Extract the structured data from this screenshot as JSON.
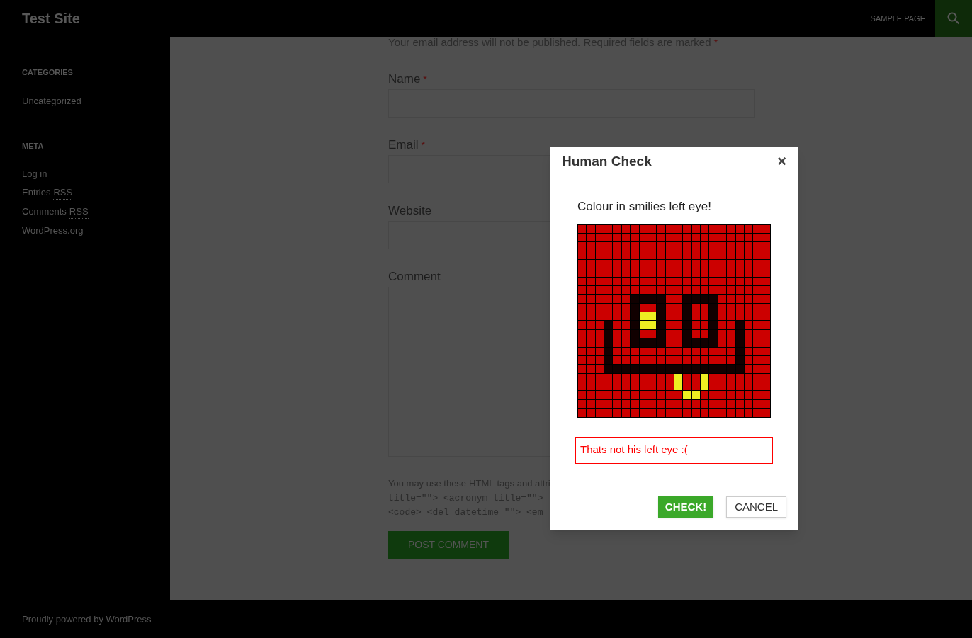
{
  "header": {
    "site_title": "Test Site",
    "nav": [
      {
        "label": "SAMPLE PAGE"
      }
    ]
  },
  "sidebar": {
    "widgets": [
      {
        "title": "CATEGORIES",
        "links": [
          {
            "text": "Uncategorized"
          }
        ]
      },
      {
        "title": "META",
        "links": [
          {
            "text": "Log in"
          },
          {
            "text": "Entries",
            "abbr": "RSS"
          },
          {
            "text": "Comments",
            "abbr": "RSS"
          },
          {
            "text": "WordPress.org"
          }
        ]
      }
    ]
  },
  "form": {
    "notes": "Your email address will not be published. Required fields are marked",
    "notes_mark": "*",
    "fields": [
      {
        "label": "Name",
        "required_mark": "*",
        "kind": "input"
      },
      {
        "label": "Email",
        "required_mark": "*",
        "kind": "input"
      },
      {
        "label": "Website",
        "kind": "input"
      },
      {
        "label": "Comment",
        "kind": "textarea"
      }
    ],
    "allowed_tags": {
      "before": "You may use these",
      "abbr": "HTML",
      "after": "tags and attri",
      "code_lines": [
        "title=\"\"> <acronym title=\"\">",
        "<code> <del datetime=\"\"> <em"
      ]
    },
    "submit": "POST COMMENT"
  },
  "footer": {
    "text": "Proudly powered by WordPress"
  },
  "modal": {
    "title": "Human Check",
    "close": "×",
    "prompt": "Colour in smilies left eye!",
    "captcha": {
      "rows": [
        {
          "cells": [
            {
              "color": "#cc0000"
            },
            {
              "color": "#cc0000"
            },
            {
              "color": "#cc0000"
            },
            {
              "color": "#cc0000"
            },
            {
              "color": "#cc0000"
            },
            {
              "color": "#cc0000"
            },
            {
              "color": "#cc0000"
            },
            {
              "color": "#cc0000"
            },
            {
              "color": "#cc0000"
            },
            {
              "color": "#cc0000"
            },
            {
              "color": "#cc0000"
            },
            {
              "color": "#cc0000"
            },
            {
              "color": "#cc0000"
            },
            {
              "color": "#cc0000"
            },
            {
              "color": "#cc0000"
            },
            {
              "color": "#cc0000"
            },
            {
              "color": "#cc0000"
            },
            {
              "color": "#cc0000"
            },
            {
              "color": "#cc0000"
            },
            {
              "color": "#cc0000"
            },
            {
              "color": "#cc0000"
            },
            {
              "color": "#cc0000"
            }
          ]
        },
        {
          "cells": [
            {
              "color": "#cc0000"
            },
            {
              "color": "#cc0000"
            },
            {
              "color": "#cc0000"
            },
            {
              "color": "#cc0000"
            },
            {
              "color": "#cc0000"
            },
            {
              "color": "#cc0000"
            },
            {
              "color": "#cc0000"
            },
            {
              "color": "#cc0000"
            },
            {
              "color": "#cc0000"
            },
            {
              "color": "#cc0000"
            },
            {
              "color": "#cc0000"
            },
            {
              "color": "#cc0000"
            },
            {
              "color": "#cc0000"
            },
            {
              "color": "#cc0000"
            },
            {
              "color": "#cc0000"
            },
            {
              "color": "#cc0000"
            },
            {
              "color": "#cc0000"
            },
            {
              "color": "#cc0000"
            },
            {
              "color": "#cc0000"
            },
            {
              "color": "#cc0000"
            },
            {
              "color": "#cc0000"
            },
            {
              "color": "#cc0000"
            }
          ]
        },
        {
          "cells": [
            {
              "color": "#cc0000"
            },
            {
              "color": "#cc0000"
            },
            {
              "color": "#cc0000"
            },
            {
              "color": "#cc0000"
            },
            {
              "color": "#cc0000"
            },
            {
              "color": "#cc0000"
            },
            {
              "color": "#cc0000"
            },
            {
              "color": "#cc0000"
            },
            {
              "color": "#cc0000"
            },
            {
              "color": "#cc0000"
            },
            {
              "color": "#cc0000"
            },
            {
              "color": "#cc0000"
            },
            {
              "color": "#cc0000"
            },
            {
              "color": "#cc0000"
            },
            {
              "color": "#cc0000"
            },
            {
              "color": "#cc0000"
            },
            {
              "color": "#cc0000"
            },
            {
              "color": "#cc0000"
            },
            {
              "color": "#cc0000"
            },
            {
              "color": "#cc0000"
            },
            {
              "color": "#cc0000"
            },
            {
              "color": "#cc0000"
            }
          ]
        },
        {
          "cells": [
            {
              "color": "#cc0000"
            },
            {
              "color": "#cc0000"
            },
            {
              "color": "#cc0000"
            },
            {
              "color": "#cc0000"
            },
            {
              "color": "#cc0000"
            },
            {
              "color": "#cc0000"
            },
            {
              "color": "#cc0000"
            },
            {
              "color": "#cc0000"
            },
            {
              "color": "#cc0000"
            },
            {
              "color": "#cc0000"
            },
            {
              "color": "#cc0000"
            },
            {
              "color": "#cc0000"
            },
            {
              "color": "#cc0000"
            },
            {
              "color": "#cc0000"
            },
            {
              "color": "#cc0000"
            },
            {
              "color": "#cc0000"
            },
            {
              "color": "#cc0000"
            },
            {
              "color": "#cc0000"
            },
            {
              "color": "#cc0000"
            },
            {
              "color": "#cc0000"
            },
            {
              "color": "#cc0000"
            },
            {
              "color": "#cc0000"
            }
          ]
        },
        {
          "cells": [
            {
              "color": "#cc0000"
            },
            {
              "color": "#cc0000"
            },
            {
              "color": "#cc0000"
            },
            {
              "color": "#cc0000"
            },
            {
              "color": "#cc0000"
            },
            {
              "color": "#cc0000"
            },
            {
              "color": "#cc0000"
            },
            {
              "color": "#cc0000"
            },
            {
              "color": "#cc0000"
            },
            {
              "color": "#cc0000"
            },
            {
              "color": "#cc0000"
            },
            {
              "color": "#cc0000"
            },
            {
              "color": "#cc0000"
            },
            {
              "color": "#cc0000"
            },
            {
              "color": "#cc0000"
            },
            {
              "color": "#cc0000"
            },
            {
              "color": "#cc0000"
            },
            {
              "color": "#cc0000"
            },
            {
              "color": "#cc0000"
            },
            {
              "color": "#cc0000"
            },
            {
              "color": "#cc0000"
            },
            {
              "color": "#cc0000"
            }
          ]
        },
        {
          "cells": [
            {
              "color": "#cc0000"
            },
            {
              "color": "#cc0000"
            },
            {
              "color": "#cc0000"
            },
            {
              "color": "#cc0000"
            },
            {
              "color": "#cc0000"
            },
            {
              "color": "#cc0000"
            },
            {
              "color": "#cc0000"
            },
            {
              "color": "#cc0000"
            },
            {
              "color": "#cc0000"
            },
            {
              "color": "#cc0000"
            },
            {
              "color": "#cc0000"
            },
            {
              "color": "#cc0000"
            },
            {
              "color": "#cc0000"
            },
            {
              "color": "#cc0000"
            },
            {
              "color": "#cc0000"
            },
            {
              "color": "#cc0000"
            },
            {
              "color": "#cc0000"
            },
            {
              "color": "#cc0000"
            },
            {
              "color": "#cc0000"
            },
            {
              "color": "#cc0000"
            },
            {
              "color": "#cc0000"
            },
            {
              "color": "#cc0000"
            }
          ]
        },
        {
          "cells": [
            {
              "color": "#cc0000"
            },
            {
              "color": "#cc0000"
            },
            {
              "color": "#cc0000"
            },
            {
              "color": "#cc0000"
            },
            {
              "color": "#cc0000"
            },
            {
              "color": "#cc0000"
            },
            {
              "color": "#cc0000"
            },
            {
              "color": "#cc0000"
            },
            {
              "color": "#cc0000"
            },
            {
              "color": "#cc0000"
            },
            {
              "color": "#cc0000"
            },
            {
              "color": "#cc0000"
            },
            {
              "color": "#cc0000"
            },
            {
              "color": "#cc0000"
            },
            {
              "color": "#cc0000"
            },
            {
              "color": "#cc0000"
            },
            {
              "color": "#cc0000"
            },
            {
              "color": "#cc0000"
            },
            {
              "color": "#cc0000"
            },
            {
              "color": "#cc0000"
            },
            {
              "color": "#cc0000"
            },
            {
              "color": "#cc0000"
            }
          ]
        },
        {
          "cells": [
            {
              "color": "#cc0000"
            },
            {
              "color": "#cc0000"
            },
            {
              "color": "#cc0000"
            },
            {
              "color": "#cc0000"
            },
            {
              "color": "#cc0000"
            },
            {
              "color": "#cc0000"
            },
            {
              "color": "#cc0000"
            },
            {
              "color": "#cc0000"
            },
            {
              "color": "#cc0000"
            },
            {
              "color": "#cc0000"
            },
            {
              "color": "#cc0000"
            },
            {
              "color": "#cc0000"
            },
            {
              "color": "#cc0000"
            },
            {
              "color": "#cc0000"
            },
            {
              "color": "#cc0000"
            },
            {
              "color": "#cc0000"
            },
            {
              "color": "#cc0000"
            },
            {
              "color": "#cc0000"
            },
            {
              "color": "#cc0000"
            },
            {
              "color": "#cc0000"
            },
            {
              "color": "#cc0000"
            },
            {
              "color": "#cc0000"
            }
          ]
        },
        {
          "cells": [
            {
              "color": "#cc0000"
            },
            {
              "color": "#cc0000"
            },
            {
              "color": "#cc0000"
            },
            {
              "color": "#cc0000"
            },
            {
              "color": "#cc0000"
            },
            {
              "color": "#cc0000"
            },
            {
              "color": "#110000"
            },
            {
              "color": "#110000"
            },
            {
              "color": "#110000"
            },
            {
              "color": "#110000"
            },
            {
              "color": "#cc0000"
            },
            {
              "color": "#cc0000"
            },
            {
              "color": "#110000"
            },
            {
              "color": "#110000"
            },
            {
              "color": "#110000"
            },
            {
              "color": "#110000"
            },
            {
              "color": "#cc0000"
            },
            {
              "color": "#cc0000"
            },
            {
              "color": "#cc0000"
            },
            {
              "color": "#cc0000"
            },
            {
              "color": "#cc0000"
            },
            {
              "color": "#cc0000"
            }
          ]
        },
        {
          "cells": [
            {
              "color": "#cc0000"
            },
            {
              "color": "#cc0000"
            },
            {
              "color": "#cc0000"
            },
            {
              "color": "#cc0000"
            },
            {
              "color": "#cc0000"
            },
            {
              "color": "#cc0000"
            },
            {
              "color": "#110000"
            },
            {
              "color": "#cc0000"
            },
            {
              "color": "#cc0000"
            },
            {
              "color": "#110000"
            },
            {
              "color": "#cc0000"
            },
            {
              "color": "#cc0000"
            },
            {
              "color": "#110000"
            },
            {
              "color": "#cc0000"
            },
            {
              "color": "#cc0000"
            },
            {
              "color": "#110000"
            },
            {
              "color": "#cc0000"
            },
            {
              "color": "#cc0000"
            },
            {
              "color": "#cc0000"
            },
            {
              "color": "#cc0000"
            },
            {
              "color": "#cc0000"
            },
            {
              "color": "#cc0000"
            }
          ]
        },
        {
          "cells": [
            {
              "color": "#cc0000"
            },
            {
              "color": "#cc0000"
            },
            {
              "color": "#cc0000"
            },
            {
              "color": "#cc0000"
            },
            {
              "color": "#cc0000"
            },
            {
              "color": "#cc0000"
            },
            {
              "color": "#110000"
            },
            {
              "color": "#eeee22"
            },
            {
              "color": "#eeee22"
            },
            {
              "color": "#110000"
            },
            {
              "color": "#cc0000"
            },
            {
              "color": "#cc0000"
            },
            {
              "color": "#110000"
            },
            {
              "color": "#cc0000"
            },
            {
              "color": "#cc0000"
            },
            {
              "color": "#110000"
            },
            {
              "color": "#cc0000"
            },
            {
              "color": "#cc0000"
            },
            {
              "color": "#cc0000"
            },
            {
              "color": "#cc0000"
            },
            {
              "color": "#cc0000"
            },
            {
              "color": "#cc0000"
            }
          ]
        },
        {
          "cells": [
            {
              "color": "#cc0000"
            },
            {
              "color": "#cc0000"
            },
            {
              "color": "#cc0000"
            },
            {
              "color": "#110000"
            },
            {
              "color": "#cc0000"
            },
            {
              "color": "#cc0000"
            },
            {
              "color": "#110000"
            },
            {
              "color": "#eeee22"
            },
            {
              "color": "#eeee22"
            },
            {
              "color": "#110000"
            },
            {
              "color": "#cc0000"
            },
            {
              "color": "#cc0000"
            },
            {
              "color": "#110000"
            },
            {
              "color": "#cc0000"
            },
            {
              "color": "#cc0000"
            },
            {
              "color": "#110000"
            },
            {
              "color": "#cc0000"
            },
            {
              "color": "#cc0000"
            },
            {
              "color": "#110000"
            },
            {
              "color": "#cc0000"
            },
            {
              "color": "#cc0000"
            },
            {
              "color": "#cc0000"
            }
          ]
        },
        {
          "cells": [
            {
              "color": "#cc0000"
            },
            {
              "color": "#cc0000"
            },
            {
              "color": "#cc0000"
            },
            {
              "color": "#110000"
            },
            {
              "color": "#cc0000"
            },
            {
              "color": "#cc0000"
            },
            {
              "color": "#110000"
            },
            {
              "color": "#cc0000"
            },
            {
              "color": "#cc0000"
            },
            {
              "color": "#110000"
            },
            {
              "color": "#cc0000"
            },
            {
              "color": "#cc0000"
            },
            {
              "color": "#110000"
            },
            {
              "color": "#cc0000"
            },
            {
              "color": "#cc0000"
            },
            {
              "color": "#110000"
            },
            {
              "color": "#cc0000"
            },
            {
              "color": "#cc0000"
            },
            {
              "color": "#110000"
            },
            {
              "color": "#cc0000"
            },
            {
              "color": "#cc0000"
            },
            {
              "color": "#cc0000"
            }
          ]
        },
        {
          "cells": [
            {
              "color": "#cc0000"
            },
            {
              "color": "#cc0000"
            },
            {
              "color": "#cc0000"
            },
            {
              "color": "#110000"
            },
            {
              "color": "#cc0000"
            },
            {
              "color": "#cc0000"
            },
            {
              "color": "#110000"
            },
            {
              "color": "#110000"
            },
            {
              "color": "#110000"
            },
            {
              "color": "#110000"
            },
            {
              "color": "#cc0000"
            },
            {
              "color": "#cc0000"
            },
            {
              "color": "#110000"
            },
            {
              "color": "#110000"
            },
            {
              "color": "#110000"
            },
            {
              "color": "#110000"
            },
            {
              "color": "#cc0000"
            },
            {
              "color": "#cc0000"
            },
            {
              "color": "#110000"
            },
            {
              "color": "#cc0000"
            },
            {
              "color": "#cc0000"
            },
            {
              "color": "#cc0000"
            }
          ]
        },
        {
          "cells": [
            {
              "color": "#cc0000"
            },
            {
              "color": "#cc0000"
            },
            {
              "color": "#cc0000"
            },
            {
              "color": "#110000"
            },
            {
              "color": "#cc0000"
            },
            {
              "color": "#cc0000"
            },
            {
              "color": "#cc0000"
            },
            {
              "color": "#cc0000"
            },
            {
              "color": "#cc0000"
            },
            {
              "color": "#cc0000"
            },
            {
              "color": "#cc0000"
            },
            {
              "color": "#cc0000"
            },
            {
              "color": "#cc0000"
            },
            {
              "color": "#cc0000"
            },
            {
              "color": "#cc0000"
            },
            {
              "color": "#cc0000"
            },
            {
              "color": "#cc0000"
            },
            {
              "color": "#cc0000"
            },
            {
              "color": "#110000"
            },
            {
              "color": "#cc0000"
            },
            {
              "color": "#cc0000"
            },
            {
              "color": "#cc0000"
            }
          ]
        },
        {
          "cells": [
            {
              "color": "#cc0000"
            },
            {
              "color": "#cc0000"
            },
            {
              "color": "#cc0000"
            },
            {
              "color": "#110000"
            },
            {
              "color": "#cc0000"
            },
            {
              "color": "#cc0000"
            },
            {
              "color": "#cc0000"
            },
            {
              "color": "#cc0000"
            },
            {
              "color": "#cc0000"
            },
            {
              "color": "#cc0000"
            },
            {
              "color": "#cc0000"
            },
            {
              "color": "#cc0000"
            },
            {
              "color": "#cc0000"
            },
            {
              "color": "#cc0000"
            },
            {
              "color": "#cc0000"
            },
            {
              "color": "#cc0000"
            },
            {
              "color": "#cc0000"
            },
            {
              "color": "#cc0000"
            },
            {
              "color": "#110000"
            },
            {
              "color": "#cc0000"
            },
            {
              "color": "#cc0000"
            },
            {
              "color": "#cc0000"
            }
          ]
        },
        {
          "cells": [
            {
              "color": "#cc0000"
            },
            {
              "color": "#cc0000"
            },
            {
              "color": "#cc0000"
            },
            {
              "color": "#110000"
            },
            {
              "color": "#110000"
            },
            {
              "color": "#110000"
            },
            {
              "color": "#110000"
            },
            {
              "color": "#110000"
            },
            {
              "color": "#110000"
            },
            {
              "color": "#110000"
            },
            {
              "color": "#110000"
            },
            {
              "color": "#110000"
            },
            {
              "color": "#110000"
            },
            {
              "color": "#110000"
            },
            {
              "color": "#110000"
            },
            {
              "color": "#110000"
            },
            {
              "color": "#110000"
            },
            {
              "color": "#110000"
            },
            {
              "color": "#110000"
            },
            {
              "color": "#cc0000"
            },
            {
              "color": "#cc0000"
            },
            {
              "color": "#cc0000"
            }
          ]
        },
        {
          "cells": [
            {
              "color": "#cc0000"
            },
            {
              "color": "#cc0000"
            },
            {
              "color": "#cc0000"
            },
            {
              "color": "#cc0000"
            },
            {
              "color": "#cc0000"
            },
            {
              "color": "#cc0000"
            },
            {
              "color": "#cc0000"
            },
            {
              "color": "#cc0000"
            },
            {
              "color": "#cc0000"
            },
            {
              "color": "#cc0000"
            },
            {
              "color": "#cc0000"
            },
            {
              "color": "#eeee22"
            },
            {
              "color": "#cc0000"
            },
            {
              "color": "#cc0000"
            },
            {
              "color": "#eeee22"
            },
            {
              "color": "#cc0000"
            },
            {
              "color": "#cc0000"
            },
            {
              "color": "#cc0000"
            },
            {
              "color": "#cc0000"
            },
            {
              "color": "#cc0000"
            },
            {
              "color": "#cc0000"
            },
            {
              "color": "#cc0000"
            }
          ]
        },
        {
          "cells": [
            {
              "color": "#cc0000"
            },
            {
              "color": "#cc0000"
            },
            {
              "color": "#cc0000"
            },
            {
              "color": "#cc0000"
            },
            {
              "color": "#cc0000"
            },
            {
              "color": "#cc0000"
            },
            {
              "color": "#cc0000"
            },
            {
              "color": "#cc0000"
            },
            {
              "color": "#cc0000"
            },
            {
              "color": "#cc0000"
            },
            {
              "color": "#cc0000"
            },
            {
              "color": "#eeee22"
            },
            {
              "color": "#cc0000"
            },
            {
              "color": "#cc0000"
            },
            {
              "color": "#eeee22"
            },
            {
              "color": "#cc0000"
            },
            {
              "color": "#cc0000"
            },
            {
              "color": "#cc0000"
            },
            {
              "color": "#cc0000"
            },
            {
              "color": "#cc0000"
            },
            {
              "color": "#cc0000"
            },
            {
              "color": "#cc0000"
            }
          ]
        },
        {
          "cells": [
            {
              "color": "#cc0000"
            },
            {
              "color": "#cc0000"
            },
            {
              "color": "#cc0000"
            },
            {
              "color": "#cc0000"
            },
            {
              "color": "#cc0000"
            },
            {
              "color": "#cc0000"
            },
            {
              "color": "#cc0000"
            },
            {
              "color": "#cc0000"
            },
            {
              "color": "#cc0000"
            },
            {
              "color": "#cc0000"
            },
            {
              "color": "#cc0000"
            },
            {
              "color": "#cc0000"
            },
            {
              "color": "#eeee22"
            },
            {
              "color": "#eeee22"
            },
            {
              "color": "#cc0000"
            },
            {
              "color": "#cc0000"
            },
            {
              "color": "#cc0000"
            },
            {
              "color": "#cc0000"
            },
            {
              "color": "#cc0000"
            },
            {
              "color": "#cc0000"
            },
            {
              "color": "#cc0000"
            },
            {
              "color": "#cc0000"
            }
          ]
        },
        {
          "cells": [
            {
              "color": "#cc0000"
            },
            {
              "color": "#cc0000"
            },
            {
              "color": "#cc0000"
            },
            {
              "color": "#cc0000"
            },
            {
              "color": "#cc0000"
            },
            {
              "color": "#cc0000"
            },
            {
              "color": "#cc0000"
            },
            {
              "color": "#cc0000"
            },
            {
              "color": "#cc0000"
            },
            {
              "color": "#cc0000"
            },
            {
              "color": "#cc0000"
            },
            {
              "color": "#cc0000"
            },
            {
              "color": "#cc0000"
            },
            {
              "color": "#cc0000"
            },
            {
              "color": "#cc0000"
            },
            {
              "color": "#cc0000"
            },
            {
              "color": "#cc0000"
            },
            {
              "color": "#cc0000"
            },
            {
              "color": "#cc0000"
            },
            {
              "color": "#cc0000"
            },
            {
              "color": "#cc0000"
            },
            {
              "color": "#cc0000"
            }
          ]
        },
        {
          "cells": [
            {
              "color": "#cc0000"
            },
            {
              "color": "#cc0000"
            },
            {
              "color": "#cc0000"
            },
            {
              "color": "#cc0000"
            },
            {
              "color": "#cc0000"
            },
            {
              "color": "#cc0000"
            },
            {
              "color": "#cc0000"
            },
            {
              "color": "#cc0000"
            },
            {
              "color": "#cc0000"
            },
            {
              "color": "#cc0000"
            },
            {
              "color": "#cc0000"
            },
            {
              "color": "#cc0000"
            },
            {
              "color": "#cc0000"
            },
            {
              "color": "#cc0000"
            },
            {
              "color": "#cc0000"
            },
            {
              "color": "#cc0000"
            },
            {
              "color": "#cc0000"
            },
            {
              "color": "#cc0000"
            },
            {
              "color": "#cc0000"
            },
            {
              "color": "#cc0000"
            },
            {
              "color": "#cc0000"
            },
            {
              "color": "#cc0000"
            }
          ]
        }
      ]
    },
    "error": "Thats not his left eye :(",
    "buttons": [
      {
        "label": "CHECK!",
        "kind": "primary"
      },
      {
        "label": "CANCEL",
        "kind": "secondary"
      }
    ]
  }
}
